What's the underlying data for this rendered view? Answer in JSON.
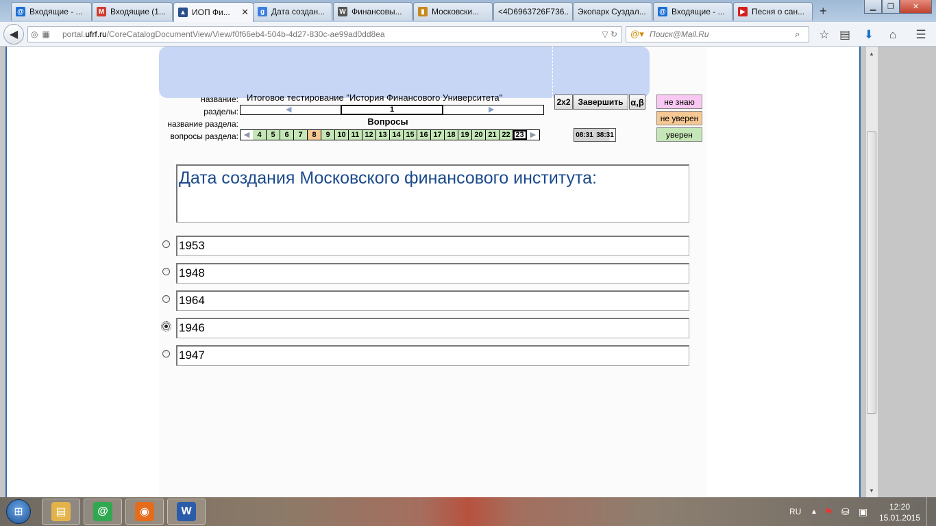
{
  "browser": {
    "tabs": [
      {
        "label": "Входящие - ...",
        "icon": "mail-ru-icon",
        "color": "#1a6fd6",
        "glyph": "@"
      },
      {
        "label": "Входящие (1...",
        "icon": "gmail-icon",
        "color": "#d23a2e",
        "glyph": "M"
      },
      {
        "label": "ИОП Фи...",
        "icon": "graduation-cap-icon",
        "color": "#2b4f8c",
        "glyph": "▲",
        "active": true,
        "close": "✕"
      },
      {
        "label": "Дата создан...",
        "icon": "google-icon",
        "color": "#3b7de0",
        "glyph": "g"
      },
      {
        "label": "Финансовы...",
        "icon": "wikipedia-icon",
        "color": "#555555",
        "glyph": "W"
      },
      {
        "label": "Московски...",
        "icon": "bar-chart-icon",
        "color": "#c9881d",
        "glyph": "▮"
      },
      {
        "label": "<4D6963726F736...",
        "icon": "",
        "color": "",
        "glyph": ""
      },
      {
        "label": "Экопарк Суздал...",
        "icon": "",
        "color": "",
        "glyph": ""
      },
      {
        "label": "Входящие - ...",
        "icon": "mail-ru-icon",
        "color": "#1a6fd6",
        "glyph": "@"
      },
      {
        "label": "Песня о сан...",
        "icon": "youtube-icon",
        "color": "#d42020",
        "glyph": "▶"
      }
    ],
    "new_tab": "+",
    "url_host_prefix": "portal.",
    "url_host": "ufrf.ru",
    "url_path": "/CoreCatalogDocumentView/View/f0f66eb4-504b-4d27-830c-ae99ad0dd8ea",
    "search_placeholder": "Поиск@Mail.Ru"
  },
  "test": {
    "title_label": "название:",
    "title": "Итоговое тестирование \"История Финансового Университета\"",
    "sections_label": "разделы:",
    "current_section": "1",
    "section_name_label": "название раздела:",
    "section_name": "Вопросы",
    "questions_label": "вопросы раздела:",
    "questions": [
      {
        "n": "4",
        "state": "answered-sure"
      },
      {
        "n": "5",
        "state": "answered-sure"
      },
      {
        "n": "6",
        "state": "answered-sure"
      },
      {
        "n": "7",
        "state": "answered-sure"
      },
      {
        "n": "8",
        "state": "answered-unsure"
      },
      {
        "n": "9",
        "state": "answered-sure"
      },
      {
        "n": "10",
        "state": "answered-sure"
      },
      {
        "n": "11",
        "state": "answered-sure"
      },
      {
        "n": "12",
        "state": "answered-sure"
      },
      {
        "n": "13",
        "state": "answered-sure"
      },
      {
        "n": "14",
        "state": "answered-sure"
      },
      {
        "n": "15",
        "state": "answered-sure"
      },
      {
        "n": "16",
        "state": "answered-sure"
      },
      {
        "n": "17",
        "state": "answered-sure"
      },
      {
        "n": "18",
        "state": "answered-sure"
      },
      {
        "n": "19",
        "state": "answered-sure"
      },
      {
        "n": "20",
        "state": "answered-sure"
      },
      {
        "n": "21",
        "state": "answered-sure"
      },
      {
        "n": "22",
        "state": "answered-sure"
      },
      {
        "n": "23",
        "state": "current"
      }
    ],
    "btn_2x2": "2x2",
    "btn_finish": "Завершить",
    "btn_alpha": "α,β",
    "timer_elapsed": "08:31",
    "timer_total": "38:31",
    "timer_fraction": 0.86,
    "confidence": [
      {
        "label": "не знаю",
        "color": "#f9c8f2"
      },
      {
        "label": "не уверен",
        "color": "#f6c894"
      },
      {
        "label": "уверен",
        "color": "#c5e6b7"
      }
    ],
    "question_text": "Дата создания Московского финансового института:",
    "answers": [
      {
        "text": "1953",
        "selected": false
      },
      {
        "text": "1948",
        "selected": false
      },
      {
        "text": "1964",
        "selected": false
      },
      {
        "text": "1946",
        "selected": true
      },
      {
        "text": "1947",
        "selected": false
      }
    ]
  },
  "taskbar": {
    "apps": [
      {
        "name": "file-explorer-icon",
        "glyph": "▤",
        "color": "#e3b34a"
      },
      {
        "name": "mail-agent-icon",
        "glyph": "@",
        "color": "#2fa84f"
      },
      {
        "name": "firefox-icon",
        "glyph": "◉",
        "color": "#e46c1c"
      },
      {
        "name": "word-icon",
        "glyph": "W",
        "color": "#2a5caa"
      }
    ],
    "lang": "RU",
    "time": "12:20",
    "date": "15.01.2015"
  }
}
